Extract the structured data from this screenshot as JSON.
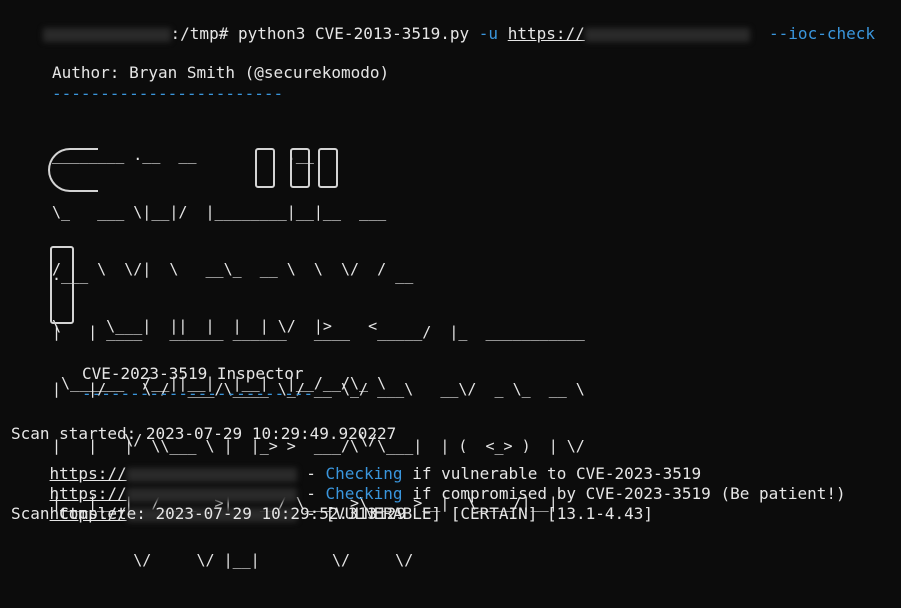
{
  "command": {
    "prompt_path": ":/tmp# ",
    "program": "python3 CVE-2013-3519.py ",
    "flag_u": "-u",
    "url_prefix": "https://",
    "flag_ioc": "--ioc-check"
  },
  "banner": {
    "author": "Author: Bryan Smith (@securekomodo)",
    "author_rule": "------------------------",
    "ascii_top": [
      "________ .__  __          .__",
      "\\_   ___ \\|__|/  |________|__|__  ___",
      "/    \\  \\/|  \\   __\\_  __ \\  \\  \\/  /",
      "\\     \\___|  ||  |  |  | \\/  |>    <",
      " \\______  /__||__|  |__|  |__/__/\\_ \\",
      "        \\/                        \\/"
    ],
    "ascii_bottom": [
      ".___                                  __",
      "|   | ____   ______ ______   ____   _____/  |_  ___________",
      "|   |/    \\ /  ___/\\____ \\_/ __ \\_/ ___\\   __\\/  _ \\_  __ \\",
      "|   |   |  \\\\___ \\ |  |_> >  ___/\\  \\___|  | (  <_> )  | \\/",
      "|___|___|  /____  >|   __/ \\___  >\\___  >__|  \\____/|__|",
      "         \\/     \\/ |__|        \\/     \\/"
    ],
    "subtitle": "CVE-2023-3519 Inspector",
    "subtitle_rule": "------------------------"
  },
  "scan": {
    "started": "Scan started: 2023-07-29 10:29:49.920227",
    "url_prefix": "https://",
    "lines": [
      {
        "sep": " - ",
        "highlight": "Checking",
        "rest": " if vulnerable to CVE-2023-3519"
      },
      {
        "sep": " - ",
        "highlight": "Checking",
        "rest": " if compromised by CVE-2023-3519 (Be patient!)"
      },
      {
        "sep": " - ",
        "highlight": "",
        "rest": "[VULNERABLE] [CERTAIN] [13.1-4.43]"
      }
    ],
    "complete": "Scan Complete: 2023-07-29 10:29:52.313129"
  },
  "colors": {
    "background": "#0c0c0c",
    "text": "#e6e6e6",
    "accent_cyan": "#3a96dd"
  }
}
